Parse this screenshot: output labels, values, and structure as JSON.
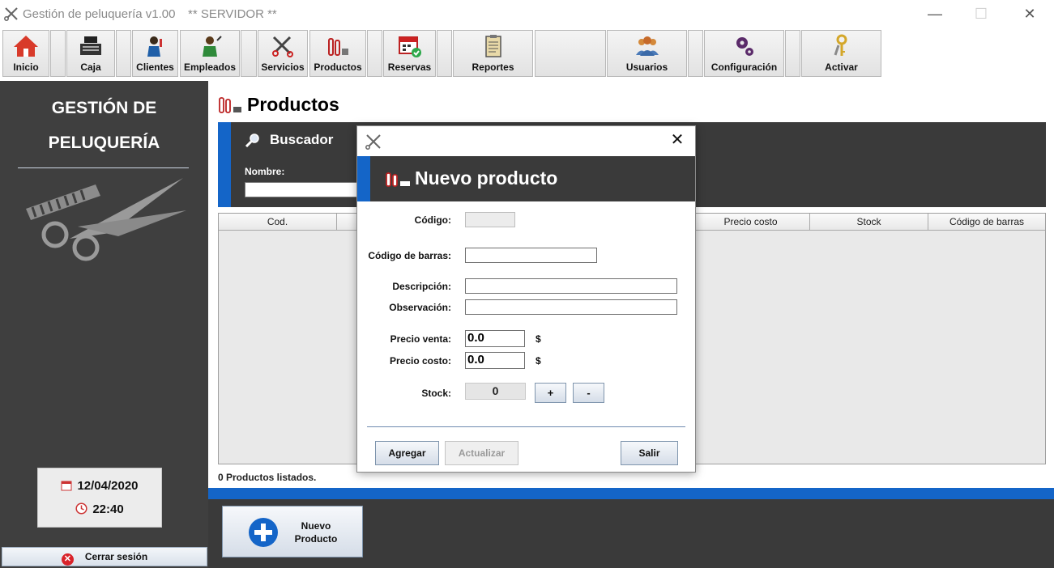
{
  "window": {
    "title": "Gestión de peluquería v1.00",
    "server": "** SERVIDOR **",
    "minimize": "—",
    "maximize": "☐",
    "close": "✕"
  },
  "toolbar": {
    "buttons": [
      {
        "label": "Inicio",
        "icon": "home-icon"
      },
      {
        "label": "Caja",
        "icon": "cash-register-icon"
      },
      {
        "label": "Clientes",
        "icon": "client-icon"
      },
      {
        "label": "Empleados",
        "icon": "employee-icon"
      },
      {
        "label": "Servicios",
        "icon": "services-icon"
      },
      {
        "label": "Productos",
        "icon": "products-icon"
      },
      {
        "label": "Reservas",
        "icon": "calendar-icon"
      },
      {
        "label": "Reportes",
        "icon": "report-icon"
      },
      {
        "label": "Usuarios",
        "icon": "users-icon"
      },
      {
        "label": "Configuración",
        "icon": "gears-icon"
      },
      {
        "label": "Activar",
        "icon": "keys-icon"
      }
    ]
  },
  "sidebar": {
    "title_line1": "GESTIÓN DE",
    "title_line2": "PELUQUERÍA",
    "date": "12/04/2020",
    "time": "22:40",
    "logout_label": "Cerrar sesión"
  },
  "main": {
    "title": "Productos",
    "search": {
      "title": "Buscador",
      "name_label": "Nombre:",
      "name_value": ""
    },
    "table": {
      "columns": [
        "Cod.",
        "",
        "",
        "",
        "Precio costo",
        "Stock",
        "Código de barras"
      ]
    },
    "listed_text": "0 Productos listados.",
    "new_button_line1": "Nuevo",
    "new_button_line2": "Producto"
  },
  "dialog": {
    "close": "✕",
    "title": "Nuevo producto",
    "fields": {
      "codigo_label": "Código:",
      "codigo_value": "",
      "barras_label": "Código de barras:",
      "barras_value": "",
      "descripcion_label": "Descripción:",
      "descripcion_value": "",
      "observacion_label": "Observación:",
      "observacion_value": "",
      "precio_venta_label": "Precio venta:",
      "precio_venta_value": "0.0",
      "precio_costo_label": "Precio costo:",
      "precio_costo_value": "0.0",
      "currency": "$",
      "stock_label": "Stock:",
      "stock_value": "0",
      "plus_label": "+",
      "minus_label": "-"
    },
    "buttons": {
      "add": "Agregar",
      "update": "Actualizar",
      "exit": "Salir"
    }
  },
  "colors": {
    "accent": "#1465c8",
    "dark_panel": "#3a3a3a",
    "sidebar": "#3f3f3f"
  }
}
